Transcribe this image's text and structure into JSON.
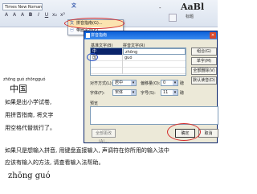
{
  "toolbar": {
    "font_name": "Times New Roman",
    "style_sample": "AaBl",
    "style_label": "标题",
    "title_fragment": "-",
    "buttons": [
      "A",
      "A",
      "A",
      "B",
      "I",
      "U",
      "x₂",
      "x²"
    ]
  },
  "dropdown": {
    "items": [
      {
        "label": "拼音指南(G)...",
        "selected": true
      },
      {
        "label": "带圈字符(E)...",
        "selected": false
      }
    ]
  },
  "document": {
    "pinyin_1": "zhōng guó   zhōngguó",
    "heading_1": "中国",
    "line_1": "如果是出小学试卷,",
    "line_2": "用拼音指南, 将文字",
    "line_3": "用空格代替就行了。",
    "line_4": "如果只是想输入拼音, 用键盘直接输入, 声调符在你所用的输入法中",
    "line_5": "应该有输入的方法, 请查看输入法帮助。",
    "pinyin_big": "zhōng guó"
  },
  "dialog": {
    "title": "拼音指南",
    "col_base": "基准文字(B)",
    "col_ruby": "拼音文字(R)",
    "rows": [
      {
        "base": "中",
        "ruby": "zhōng",
        "selected": true
      },
      {
        "base": "国",
        "ruby": "guó",
        "selected": false
      },
      {
        "base": "",
        "ruby": "",
        "selected": false
      },
      {
        "base": "",
        "ruby": "",
        "selected": false
      }
    ],
    "side_buttons": [
      "组合(G)",
      "单字(M)",
      "全部删除(V)",
      "默认读音(D)"
    ],
    "align_label": "对齐方式(L):",
    "align_value": "居中",
    "offset_label": "偏移量(O):",
    "offset_value": "0",
    "offset_unit": "磅",
    "font_label": "字体(F):",
    "font_value": "宋体",
    "size_label": "字号(S):",
    "size_value": "11",
    "size_unit": "磅",
    "preview_label": "预览",
    "default_button": "全部更改(A)...",
    "ok_button": "确定",
    "cancel_button": "取消"
  },
  "colors": {
    "annotation_red": "#d42a2a",
    "annotation_blue": "#2850c8",
    "dialog_title_bg": "#0a5fd8"
  }
}
